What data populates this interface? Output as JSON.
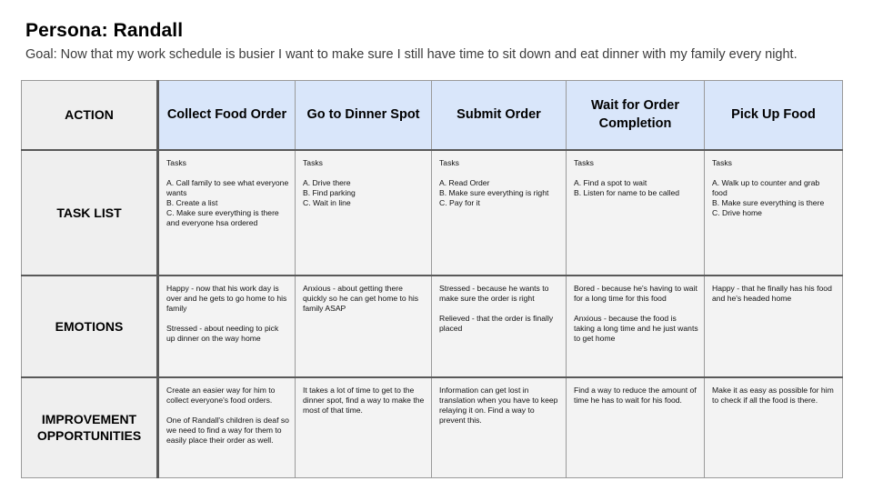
{
  "title": "Persona: Randall",
  "goal": "Goal: Now that my work schedule is busier I want to make sure I still have time to sit down and eat dinner with my family every night.",
  "corner_label": "ACTION",
  "columns": [
    "Collect Food Order",
    "Go to Dinner Spot",
    "Submit Order",
    "Wait for Order Completion",
    "Pick Up Food"
  ],
  "rows": {
    "tasks": {
      "label": "TASK LIST",
      "cells": [
        {
          "heading": "Tasks",
          "lines": [
            "A. Call family to see what everyone wants",
            "B. Create a list",
            "C. Make sure everything is there and everyone hsa ordered"
          ]
        },
        {
          "heading": "Tasks",
          "lines": [
            "A. Drive there",
            "B. Find parking",
            "C. Wait in line"
          ]
        },
        {
          "heading": "Tasks",
          "lines": [
            "A. Read Order",
            "B. Make sure everything is right",
            "C. Pay for it"
          ]
        },
        {
          "heading": "Tasks",
          "lines": [
            "A. Find a spot to wait",
            "B. Listen for name to be called"
          ]
        },
        {
          "heading": "Tasks",
          "lines": [
            "A.  Walk up to counter and grab food",
            "B. Make sure everything is there",
            "C. Drive home"
          ]
        }
      ]
    },
    "emotions": {
      "label": "EMOTIONS",
      "cells": [
        [
          "Happy - now that his work day is over and he gets to go home to his family",
          "Stressed - about needing to pick up dinner on the way home"
        ],
        [
          "Anxious - about getting there quickly so he can get home to his family ASAP"
        ],
        [
          "Stressed - because he wants to make sure the order is right",
          "Relieved - that the order is finally placed"
        ],
        [
          "Bored - because he's having to wait for a long time for this food",
          "Anxious - because the food is taking a long time and he just wants to get home"
        ],
        [
          "Happy - that he finally has his food and he's headed home"
        ]
      ]
    },
    "improvements": {
      "label": "IMPROVEMENT OPPORTUNITIES",
      "cells": [
        [
          "Create an easier way for him to collect everyone's food orders.",
          "One of Randall's children is deaf so we need to find a way for them to easily place their order as well."
        ],
        [
          "It takes a lot of time to get to the dinner spot, find a way to make the most of that time."
        ],
        [
          "Information can get lost in translation when you have to keep relaying it on. Find a way to prevent this."
        ],
        [
          "Find a way to reduce the amount of time he has to wait for his food."
        ],
        [
          "Make it as easy as possible for him to check if all the food is there."
        ]
      ]
    }
  },
  "colors": {
    "header_fill": "#d9e6fa",
    "cell_fill": "#f3f3f3",
    "label_fill": "#efefef",
    "divider": "#595959"
  }
}
